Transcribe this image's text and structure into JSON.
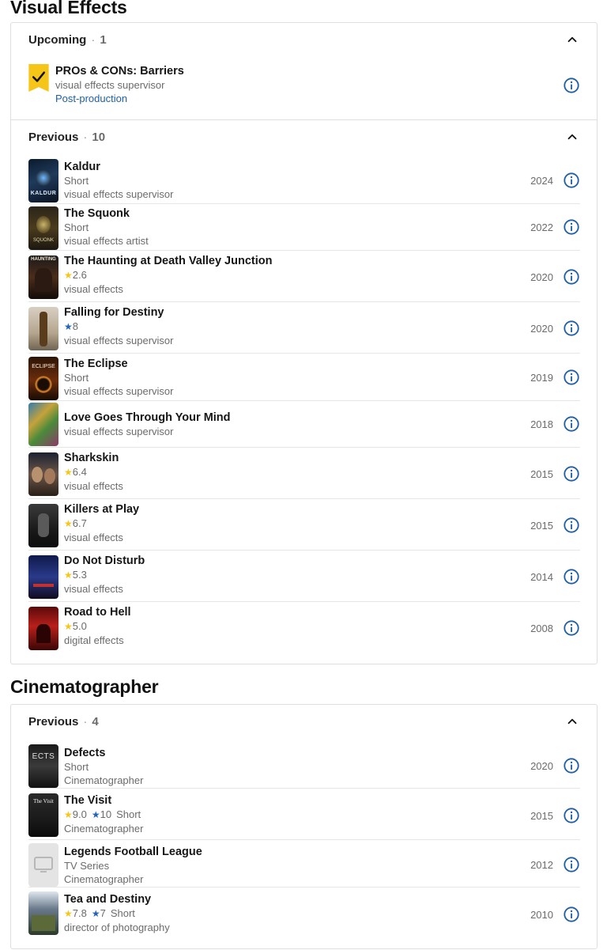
{
  "sections": {
    "vfx_title": "Visual Effects",
    "cine_title": "Cinematographer"
  },
  "upcoming": {
    "label": "Upcoming",
    "count": "1",
    "item": {
      "title": "PROs & CONs: Barriers",
      "role": "visual effects supervisor",
      "status": "Post-production"
    }
  },
  "vfx_previous": {
    "label": "Previous",
    "count": "10",
    "items": [
      {
        "title": "Kaldur",
        "line1": "Short",
        "role": "visual effects supervisor",
        "year": "2024"
      },
      {
        "title": "The Squonk",
        "line1": "Short",
        "role": "visual effects artist",
        "year": "2022"
      },
      {
        "title": "The Haunting at Death Valley Junction",
        "rating": "2.6",
        "role": "visual effects",
        "year": "2020"
      },
      {
        "title": "Falling for Destiny",
        "my_rating": "8",
        "role": "visual effects supervisor",
        "year": "2020"
      },
      {
        "title": "The Eclipse",
        "line1": "Short",
        "role": "visual effects supervisor",
        "year": "2019"
      },
      {
        "title": "Love Goes Through Your Mind",
        "role": "visual effects supervisor",
        "year": "2018"
      },
      {
        "title": "Sharkskin",
        "rating": "6.4",
        "role": "visual effects",
        "year": "2015"
      },
      {
        "title": "Killers at Play",
        "rating": "6.7",
        "role": "visual effects",
        "year": "2015"
      },
      {
        "title": "Do Not Disturb",
        "rating": "5.3",
        "role": "visual effects",
        "year": "2014"
      },
      {
        "title": "Road to Hell",
        "rating": "5.0",
        "role": "digital effects",
        "year": "2008"
      }
    ]
  },
  "cine_previous": {
    "label": "Previous",
    "count": "4",
    "items": [
      {
        "title": "Defects",
        "line1": "Short",
        "role": "Cinematographer",
        "year": "2020"
      },
      {
        "title": "The Visit",
        "rating": "9.0",
        "my_rating": "10",
        "kind": "Short",
        "role": "Cinematographer",
        "year": "2015"
      },
      {
        "title": "Legends Football League",
        "line1": "TV Series",
        "role": "Cinematographer",
        "year": "2012"
      },
      {
        "title": "Tea and Destiny",
        "rating": "7.8",
        "my_rating": "7",
        "kind": "Short",
        "role": "director of photography",
        "year": "2010"
      }
    ]
  },
  "poster_text": {
    "kaldur": "KALDUR",
    "squonk": "SQUONK",
    "haunting": "HAUNTING",
    "eclipse": "ECLIPSE",
    "defects": "ECTS",
    "visit": "The Visit"
  },
  "icons": {
    "chevron": "chevron-up-icon",
    "info": "info-circle-icon",
    "ribbon": "watchlist-check-ribbon-icon",
    "placeholder": "tv-placeholder-icon"
  },
  "colors": {
    "accent_blue": "#1f5fa6",
    "star_yellow": "#f5c518",
    "ribbon_yellow": "#f5c518",
    "text_dark": "#151515",
    "text_muted": "#6b6b6b"
  }
}
